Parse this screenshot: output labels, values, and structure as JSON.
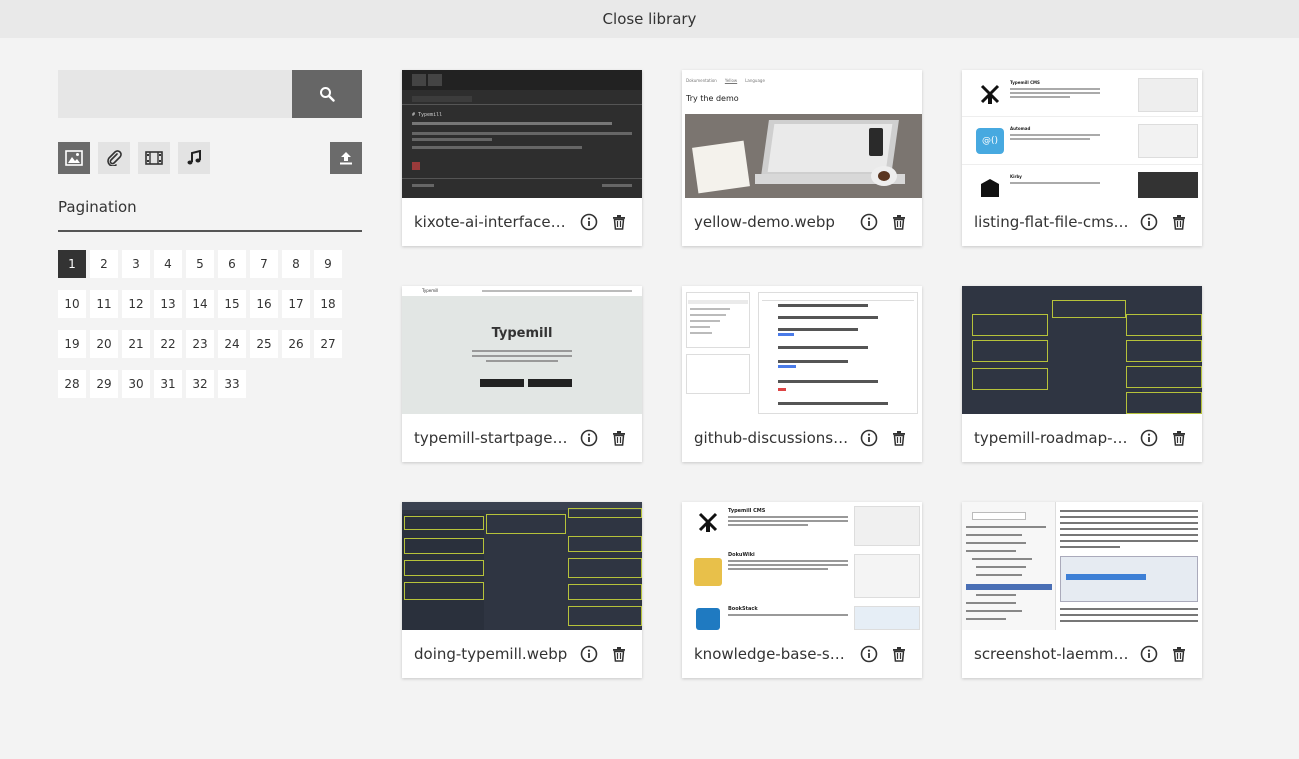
{
  "header": {
    "close_label": "Close library"
  },
  "search": {
    "placeholder": "",
    "value": ""
  },
  "filters": [
    {
      "name": "image-icon",
      "active": true
    },
    {
      "name": "attachment-icon",
      "active": false
    },
    {
      "name": "video-icon",
      "active": false
    },
    {
      "name": "audio-icon",
      "active": false
    }
  ],
  "pagination": {
    "title": "Pagination",
    "current": "1",
    "pages": [
      "1",
      "2",
      "3",
      "4",
      "5",
      "6",
      "7",
      "8",
      "9",
      "10",
      "11",
      "12",
      "13",
      "14",
      "15",
      "16",
      "17",
      "18",
      "19",
      "20",
      "21",
      "22",
      "23",
      "24",
      "25",
      "26",
      "27",
      "28",
      "29",
      "30",
      "31",
      "32",
      "33"
    ]
  },
  "files": [
    {
      "name": "kixote-ai-interface.webp"
    },
    {
      "name": "yellow-demo.webp"
    },
    {
      "name": "listing-flat-file-cms.webp"
    },
    {
      "name": "typemill-startpage.webp"
    },
    {
      "name": "github-discussions.webp"
    },
    {
      "name": "typemill-roadmap-kanban.webp"
    },
    {
      "name": "doing-typemill.webp"
    },
    {
      "name": "knowledge-base-software.webp"
    },
    {
      "name": "screenshot-laemmle.webp"
    }
  ],
  "thumbs": {
    "yellow_demo_title": "Try the demo",
    "yellow_demo_tabs": [
      "Dokumentation",
      "Yellow",
      "Language"
    ],
    "typemill_startpage_title": "Typemill",
    "typemill_logo_text": "Typemill",
    "listing_items": [
      "Typemill CMS",
      "Automad",
      "Kirby"
    ],
    "knowledge_items": [
      "Typemill CMS",
      "DokuWiki",
      "BookStack"
    ],
    "kixote_code": "# Typemill"
  }
}
